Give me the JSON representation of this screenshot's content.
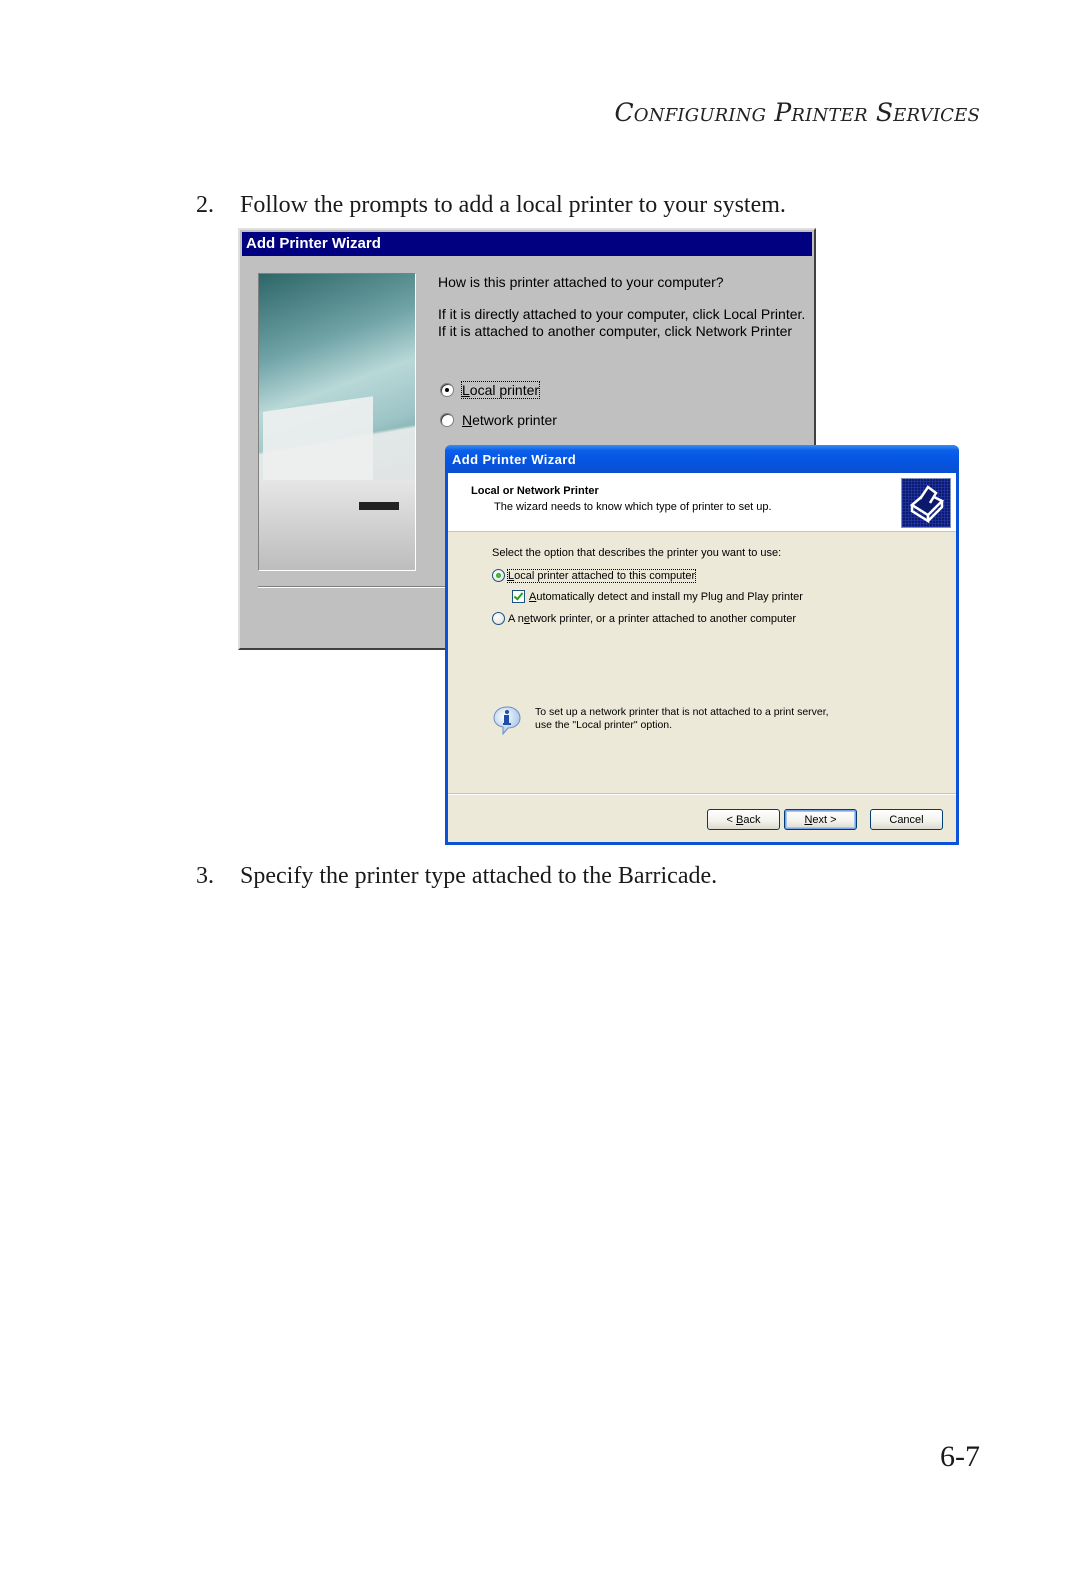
{
  "document": {
    "running_header": "Configuring Printer Services",
    "page_number": "6-7",
    "steps": [
      {
        "number": "2.",
        "text": "Follow the prompts to add a local printer to your system."
      },
      {
        "number": "3.",
        "text": "Specify the printer type attached to the Barricade."
      }
    ]
  },
  "classic_dialog": {
    "title": "Add Printer Wizard",
    "question": "How is this printer attached to your computer?",
    "description": "If it is directly attached to your computer, click Local Printer. If it is attached to another computer, click Network Printer",
    "options": [
      {
        "accel": "L",
        "rest": "ocal printer",
        "selected": true
      },
      {
        "accel": "N",
        "rest": "etwork printer",
        "selected": false
      }
    ]
  },
  "xp_dialog": {
    "title": "Add Printer Wizard",
    "header_title": "Local or Network Printer",
    "header_subtitle": "The wizard needs to know which type of printer to set up.",
    "header_icon": "printer-icon",
    "prompt": "Select the option that describes the printer you want to use:",
    "option_local": {
      "accel": "L",
      "rest": "ocal printer attached to this computer",
      "selected": true
    },
    "option_autodetect": {
      "accel": "A",
      "rest": "utomatically detect and install my Plug and Play printer",
      "checked": true
    },
    "option_network": {
      "pre": "A n",
      "accel": "e",
      "rest": "twork printer, or a printer attached to another computer",
      "selected": false
    },
    "info_icon": "info-icon",
    "info_line1": "To set up a network printer that is not attached to a print server,",
    "info_line2": "use the \"Local printer\" option.",
    "buttons": {
      "back_pre": "< ",
      "back_accel": "B",
      "back_rest": "ack",
      "next_accel": "N",
      "next_rest": "ext >",
      "cancel": "Cancel"
    }
  }
}
